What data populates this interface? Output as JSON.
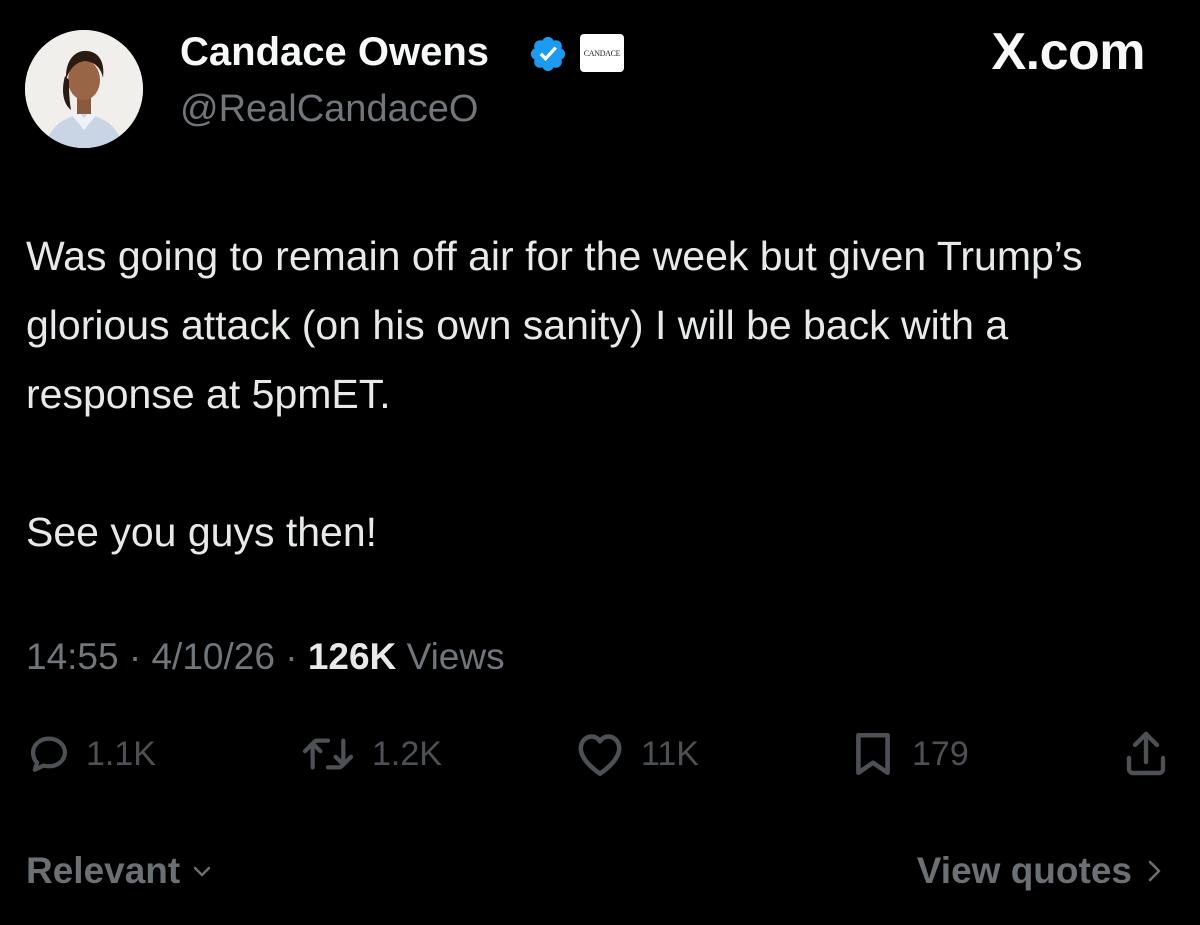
{
  "author": {
    "display_name": "Candace Owens",
    "handle": "@RealCandaceO",
    "affiliate_badge_text": "CANDACE",
    "verified_color": "#1d9bf0"
  },
  "site_label": "X.com",
  "tweet": {
    "paragraphs": [
      "Was going to remain off air for the week but given Trump’s glorious attack (on his own sanity) I will be back with a response at 5pmET.",
      "See you guys then!"
    ],
    "time": "14:55",
    "separator": "·",
    "date": "4/10/26",
    "views_count": "126K",
    "views_label": "Views"
  },
  "actions": {
    "replies": "1.1K",
    "reposts": "1.2K",
    "likes": "11K",
    "bookmarks": "179"
  },
  "footer": {
    "sort_label": "Relevant",
    "quotes_label": "View quotes"
  },
  "icons": {
    "verified": "verified-badge-icon",
    "reply": "reply-icon",
    "repost": "repost-icon",
    "like": "heart-icon",
    "bookmark": "bookmark-icon",
    "share": "share-icon",
    "sort": "chevron-down-icon",
    "quotes": "chevron-right-icon"
  }
}
